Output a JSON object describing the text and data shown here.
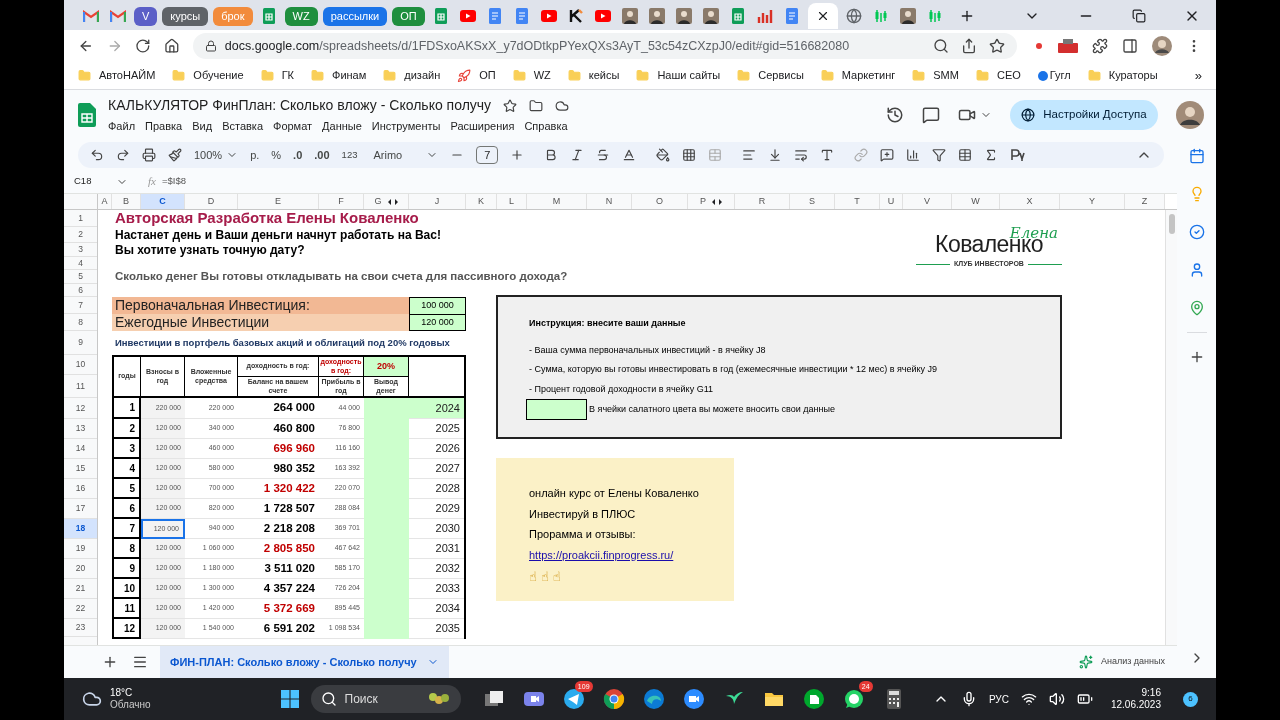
{
  "browser": {
    "tabs": [
      {
        "kind": "mail",
        "selected": false
      },
      {
        "kind": "mail",
        "selected": false
      },
      {
        "kind": "label",
        "text": "V",
        "color": "#5b5fc7",
        "selected": false
      },
      {
        "kind": "label",
        "text": "курсы",
        "color": "#5f6368",
        "selected": false
      },
      {
        "kind": "label",
        "text": "брок",
        "color": "#f28b3c",
        "selected": false
      },
      {
        "kind": "sheets",
        "selected": false
      },
      {
        "kind": "label",
        "text": "WZ",
        "color": "#1e8e3e",
        "selected": false
      },
      {
        "kind": "label",
        "text": "рассылки",
        "color": "#1a73e8",
        "selected": false
      },
      {
        "kind": "label",
        "text": "ОП",
        "color": "#1e8e3e",
        "selected": false
      },
      {
        "kind": "sheets",
        "selected": false
      },
      {
        "kind": "youtube",
        "selected": false
      },
      {
        "kind": "docs",
        "selected": false
      },
      {
        "kind": "docs",
        "selected": false
      },
      {
        "kind": "youtube",
        "selected": false
      },
      {
        "kind": "logo",
        "selected": false
      },
      {
        "kind": "youtube",
        "selected": false
      },
      {
        "kind": "photo",
        "selected": false
      },
      {
        "kind": "photo",
        "selected": false
      },
      {
        "kind": "photo",
        "selected": false
      },
      {
        "kind": "photo",
        "selected": false
      },
      {
        "kind": "sheets",
        "selected": false
      },
      {
        "kind": "chart",
        "selected": false
      },
      {
        "kind": "docs",
        "selected": false
      },
      {
        "kind": "blank",
        "selected": true
      },
      {
        "kind": "globe",
        "selected": false
      },
      {
        "kind": "stock",
        "selected": false
      },
      {
        "kind": "photo",
        "selected": false
      },
      {
        "kind": "stock",
        "selected": false
      }
    ],
    "url_host": "docs.google.com",
    "url_path": "/spreadsheets/d/1FDSxoAKSxX_y7dODtkpPYexQXs3AyT_53c54zCXzpJ0/edit#gid=516682080",
    "bookmarks": [
      {
        "kind": "folder",
        "label": "АвтоНАЙМ"
      },
      {
        "kind": "folder",
        "label": "Обучение"
      },
      {
        "kind": "folder",
        "label": "ГК"
      },
      {
        "kind": "folder",
        "label": "Финам"
      },
      {
        "kind": "folder",
        "label": "дизайн"
      },
      {
        "kind": "rocket",
        "label": "ОП"
      },
      {
        "kind": "folder",
        "label": "WZ"
      },
      {
        "kind": "folder",
        "label": "кейсы"
      },
      {
        "kind": "folder",
        "label": "Наши сайты"
      },
      {
        "kind": "folder",
        "label": "Сервисы"
      },
      {
        "kind": "folder",
        "label": "Маркетинг"
      },
      {
        "kind": "folder",
        "label": "SMM"
      },
      {
        "kind": "folder",
        "label": "СЕО"
      },
      {
        "kind": "dot",
        "label": "Гугл"
      },
      {
        "kind": "folder",
        "label": "Кураторы"
      }
    ],
    "more": "»"
  },
  "doc": {
    "title": "КАЛЬКУЛЯТОР ФинПлан: Сколько вложу - Сколько получу",
    "menu": [
      "Файл",
      "Правка",
      "Вид",
      "Вставка",
      "Формат",
      "Данные",
      "Инструменты",
      "Расширения",
      "Справка"
    ],
    "share": "Настройки Доступа",
    "toolbar": {
      "zoom": "100%",
      "currency": "р.",
      "percent": "%",
      "dec_less": ".0",
      "dec_more": ".00",
      "format": "123",
      "font": "Arimo",
      "size": "7"
    },
    "name_box": "C18",
    "fx": "fx",
    "formula": "=$I$8"
  },
  "sheet": {
    "columns": [
      {
        "label": "A",
        "selected": false,
        "hidden_after": false
      },
      {
        "label": "B",
        "selected": false,
        "hidden_after": false
      },
      {
        "label": "C",
        "selected": true,
        "hidden_after": false
      },
      {
        "label": "D",
        "selected": false,
        "hidden_after": false
      },
      {
        "label": "E",
        "selected": false,
        "hidden_after": false
      },
      {
        "label": "F",
        "selected": false,
        "hidden_after": false
      },
      {
        "label": "G",
        "selected": false,
        "hidden_after": true
      },
      {
        "label": "J",
        "selected": false,
        "hidden_after": false
      },
      {
        "label": "K",
        "selected": false,
        "hidden_after": false
      },
      {
        "label": "L",
        "selected": false,
        "hidden_after": false
      },
      {
        "label": "M",
        "selected": false,
        "hidden_after": false
      },
      {
        "label": "N",
        "selected": false,
        "hidden_after": false
      },
      {
        "label": "O",
        "selected": false,
        "hidden_after": false
      },
      {
        "label": "P",
        "selected": false,
        "hidden_after": true
      },
      {
        "label": "R",
        "selected": false,
        "hidden_after": false
      },
      {
        "label": "S",
        "selected": false,
        "hidden_after": false
      },
      {
        "label": "T",
        "selected": false,
        "hidden_after": false
      },
      {
        "label": "U",
        "selected": false,
        "hidden_after": false
      },
      {
        "label": "V",
        "selected": false,
        "hidden_after": false
      },
      {
        "label": "W",
        "selected": false,
        "hidden_after": false
      },
      {
        "label": "X",
        "selected": false,
        "hidden_after": false
      },
      {
        "label": "Y",
        "selected": false,
        "hidden_after": false
      },
      {
        "label": "Z",
        "selected": false,
        "hidden_after": false
      }
    ],
    "row_numbers": [
      {
        "label": "1",
        "selected": false
      },
      {
        "label": "2",
        "selected": false
      },
      {
        "label": "3",
        "selected": false
      },
      {
        "label": "4",
        "selected": false
      },
      {
        "label": "5",
        "selected": false
      },
      {
        "label": "6",
        "selected": false
      },
      {
        "label": "7",
        "selected": false
      },
      {
        "label": "8",
        "selected": false
      },
      {
        "label": "9",
        "selected": false
      },
      {
        "label": "10",
        "selected": false
      },
      {
        "label": "11",
        "selected": false
      },
      {
        "label": "12",
        "selected": false
      },
      {
        "label": "13",
        "selected": false
      },
      {
        "label": "14",
        "selected": false
      },
      {
        "label": "15",
        "selected": false
      },
      {
        "label": "16",
        "selected": false
      },
      {
        "label": "17",
        "selected": false
      },
      {
        "label": "18",
        "selected": true
      },
      {
        "label": "19",
        "selected": false
      },
      {
        "label": "20",
        "selected": false
      },
      {
        "label": "21",
        "selected": false
      },
      {
        "label": "22",
        "selected": false
      },
      {
        "label": "23",
        "selected": false
      }
    ],
    "heading": "Авторская Разработка Елены Коваленко",
    "line_2": "Настанет день и Ваши деньги начнут работать на Вас!",
    "line_3": "Вы хотите узнать точную дату?",
    "question": "Сколько денег Вы готовы откладывать на свои счета для пассивного дохода?",
    "inputs": [
      {
        "label": "Первоначальная Инвестиция:",
        "value": "100 000"
      },
      {
        "label": "Ежегодные Инвестиции",
        "value": "120 000"
      }
    ],
    "subtitle": "Инвестиции в портфель базовых акций и облигаций под 20% годовых",
    "table": {
      "head": {
        "years": "годы",
        "contrib": "Взносы в год",
        "invested": "Вложенные средства",
        "yield_label": "доходность в год:",
        "balance": "Баланс на вашем счете",
        "yield_label_2": "доходность в год:",
        "profit": "Прибыль в год",
        "rate": "20%",
        "withdraw": "Вывод денег"
      },
      "rows": [
        {
          "n": "1",
          "contrib": "220 000",
          "invested": "220 000",
          "balance": "264 000",
          "highlighted": false,
          "profit": "44 000",
          "year": "2024",
          "input": true,
          "selected": false
        },
        {
          "n": "2",
          "contrib": "120 000",
          "invested": "340 000",
          "balance": "460 800",
          "highlighted": false,
          "profit": "76 800",
          "year": "2025",
          "input": false,
          "selected": false
        },
        {
          "n": "3",
          "contrib": "120 000",
          "invested": "460 000",
          "balance": "696 960",
          "highlighted": true,
          "profit": "116 160",
          "year": "2026",
          "input": false,
          "selected": false
        },
        {
          "n": "4",
          "contrib": "120 000",
          "invested": "580 000",
          "balance": "980 352",
          "highlighted": false,
          "profit": "163 392",
          "year": "2027",
          "input": false,
          "selected": false
        },
        {
          "n": "5",
          "contrib": "120 000",
          "invested": "700 000",
          "balance": "1 320 422",
          "highlighted": true,
          "profit": "220 070",
          "year": "2028",
          "input": false,
          "selected": false
        },
        {
          "n": "6",
          "contrib": "120 000",
          "invested": "820 000",
          "balance": "1 728 507",
          "highlighted": false,
          "profit": "288 084",
          "year": "2029",
          "input": false,
          "selected": false
        },
        {
          "n": "7",
          "contrib": "120 000",
          "invested": "940 000",
          "balance": "2 218 208",
          "highlighted": false,
          "profit": "369 701",
          "year": "2030",
          "input": false,
          "selected": true
        },
        {
          "n": "8",
          "contrib": "120 000",
          "invested": "1 060 000",
          "balance": "2 805 850",
          "highlighted": true,
          "profit": "467 642",
          "year": "2031",
          "input": false,
          "selected": false
        },
        {
          "n": "9",
          "contrib": "120 000",
          "invested": "1 180 000",
          "balance": "3 511 020",
          "highlighted": false,
          "profit": "585 170",
          "year": "2032",
          "input": false,
          "selected": false
        },
        {
          "n": "10",
          "contrib": "120 000",
          "invested": "1 300 000",
          "balance": "4 357 224",
          "highlighted": false,
          "profit": "726 204",
          "year": "2033",
          "input": false,
          "selected": false
        },
        {
          "n": "11",
          "contrib": "120 000",
          "invested": "1 420 000",
          "balance": "5 372 669",
          "highlighted": true,
          "profit": "895 445",
          "year": "2034",
          "input": false,
          "selected": false
        },
        {
          "n": "12",
          "contrib": "120 000",
          "invested": "1 540 000",
          "balance": "6 591 202",
          "highlighted": false,
          "profit": "1 098 534",
          "year": "2035",
          "input": false,
          "selected": false
        }
      ]
    },
    "logo": {
      "script": "Елена",
      "name": "Коваленко",
      "tagline": "КЛУБ ИНВЕСТОРОВ"
    },
    "instructions": {
      "title": "Инструкция: внесите ваши данные",
      "lines": [
        "- Ваша сумма первоначальных инвестиций - в ячейку J8",
        "- Сумма, которую вы готовы инвестировать в год (ежемесячные инвестиции * 12 мес) в ячейку J9",
        "- Процент годовой доходности в ячейку G11"
      ],
      "legend": "В ячейки салатного цвета вы можете вносить свои данные"
    },
    "course": {
      "lines": [
        "онлайн курс от Елены Коваленко",
        "Инвестируй в ПЛЮС",
        "Прорамма и отзывы:"
      ],
      "link": "https://proakcii.finprogress.ru/",
      "emoji": [
        "☝",
        "☝",
        "☝"
      ]
    },
    "tab": "ФИН-ПЛАН: Сколько вложу - Сколько получу",
    "explore": "Анализ данных"
  },
  "taskbar": {
    "temp": "18°C",
    "weather": "Облачно",
    "search": "Поиск",
    "apps": [
      {
        "kind": "tasks"
      },
      {
        "kind": "meet"
      },
      {
        "kind": "telegram",
        "badge": "109"
      },
      {
        "kind": "chrome"
      },
      {
        "kind": "edge"
      },
      {
        "kind": "zoom"
      },
      {
        "kind": "bird"
      },
      {
        "kind": "folder"
      },
      {
        "kind": "evernote"
      },
      {
        "kind": "whatsapp",
        "badge": "24"
      },
      {
        "kind": "calculator"
      }
    ],
    "lang": "РУС",
    "time": "9:16",
    "date": "12.06.2023",
    "notifications": "6"
  }
}
